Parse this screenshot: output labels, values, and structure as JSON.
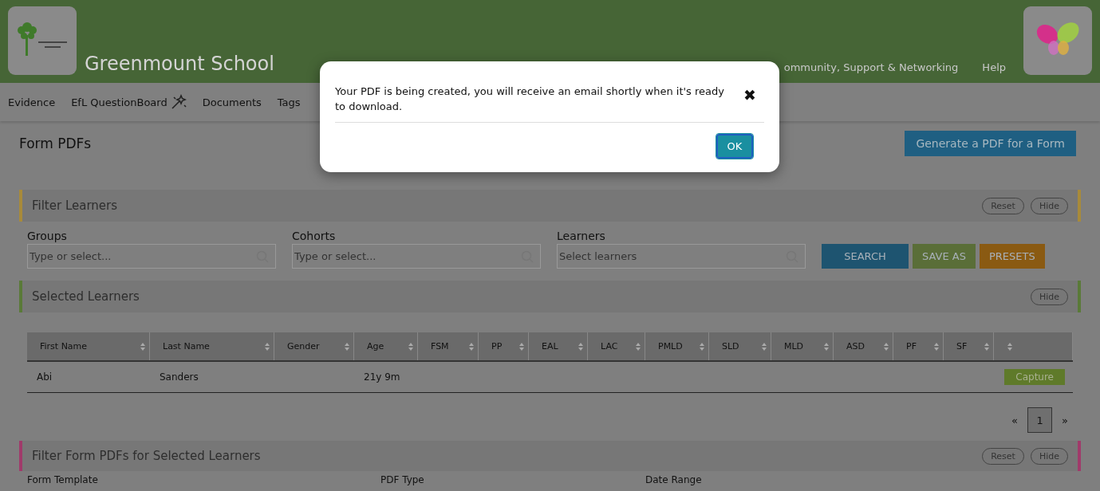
{
  "header": {
    "school_name": "Greenmount School",
    "links": [
      "ommunity, Support & Networking",
      "Help"
    ]
  },
  "nav": [
    {
      "label": "Evidence",
      "kind": "plain"
    },
    {
      "label": "EfL QuestionBoard",
      "kind": "wand"
    },
    {
      "label": "Documents",
      "kind": "plain"
    },
    {
      "label": "Tags",
      "kind": "plain"
    }
  ],
  "page_title": "Form PDFs",
  "generate_button": "Generate a PDF for a Form",
  "filter_learners": {
    "title": "Filter Learners",
    "color": "#a88a3a",
    "buttons": [
      "Reset",
      "Hide"
    ],
    "fields": [
      {
        "label": "Groups",
        "placeholder": "Type or select..."
      },
      {
        "label": "Cohorts",
        "placeholder": "Type or select..."
      },
      {
        "label": "Learners",
        "placeholder": "Select learners"
      }
    ],
    "actions": [
      {
        "label": "SEARCH",
        "color": "#1e5470"
      },
      {
        "label": "SAVE AS",
        "color": "#5a6e38"
      },
      {
        "label": "PRESETS",
        "color": "#8a5a12"
      }
    ]
  },
  "selected_learners": {
    "title": "Selected Learners",
    "color": "#5a7a38",
    "buttons": [
      "Hide"
    ],
    "columns": [
      "First Name",
      "Last Name",
      "Gender",
      "Age",
      "FSM",
      "PP",
      "EAL",
      "LAC",
      "PMLD",
      "SLD",
      "MLD",
      "ASD",
      "PF",
      "SF",
      ""
    ],
    "rows": [
      {
        "cells": [
          "Abi",
          "Sanders",
          "",
          "21y 9m",
          "",
          "",
          "",
          "",
          "",
          "",
          "",
          "",
          "",
          "",
          ""
        ],
        "action": "Capture"
      }
    ],
    "pagination": {
      "prev": "«",
      "pages": [
        {
          "label": "1",
          "selected": true
        }
      ],
      "next": "»"
    }
  },
  "filter_pdfs": {
    "title": "Filter Form PDFs for Selected Learners",
    "color": "#a03a6a",
    "buttons": [
      "Reset",
      "Hide"
    ],
    "labels": [
      "Form Template",
      "PDF Type",
      "Date Range"
    ]
  },
  "dialog": {
    "message": "Your PDF is being created, you will receive an email shortly when it's ready to download.",
    "close": "✖",
    "ok": "OK"
  }
}
